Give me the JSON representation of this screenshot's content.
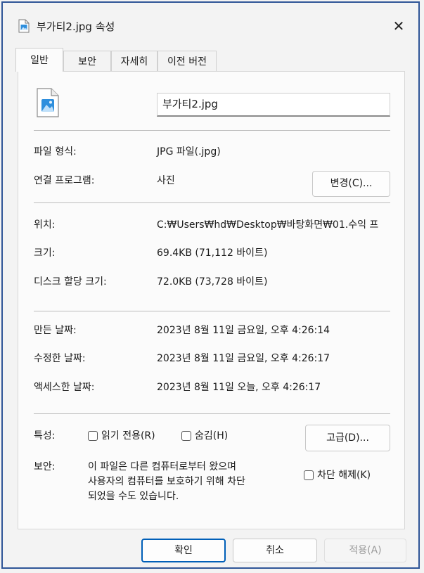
{
  "window": {
    "title": "부가티2.jpg 속성",
    "close": "✕"
  },
  "tabs": [
    {
      "label": "일반",
      "active": true
    },
    {
      "label": "보안"
    },
    {
      "label": "자세히"
    },
    {
      "label": "이전 버전"
    }
  ],
  "general": {
    "filename": "부가티2.jpg",
    "file_type_label": "파일 형식:",
    "file_type_value": "JPG 파일(.jpg)",
    "opens_with_label": "연결 프로그램:",
    "opens_with_value": "사진",
    "change_button": "변경(C)...",
    "location_label": "위치:",
    "location_value": "C:₩Users₩hd₩Desktop₩바탕화면₩01.수익 프",
    "size_label": "크기:",
    "size_value": "69.4KB (71,112 바이트)",
    "size_on_disk_label": "디스크 할당 크기:",
    "size_on_disk_value": "72.0KB (73,728 바이트)",
    "created_label": "만든 날짜:",
    "created_value": "2023년 8월 11일 금요일, 오후 4:26:14",
    "modified_label": "수정한 날짜:",
    "modified_value": "2023년 8월 11일 금요일, 오후 4:26:17",
    "accessed_label": "액세스한 날짜:",
    "accessed_value": "2023년 8월 11일 오늘, 오후 4:26:17",
    "attributes_label": "특성:",
    "readonly_label": "읽기 전용(R)",
    "hidden_label": "숨김(H)",
    "advanced_button": "고급(D)...",
    "security_label": "보안:",
    "security_text_1": "이 파일은 다른 컴퓨터로부터 왔으며",
    "security_text_2": "사용자의 컴퓨터를 보호하기 위해 차단",
    "security_text_3": "되었을 수도 있습니다.",
    "unblock_label": "차단 해제(K)"
  },
  "footer": {
    "ok": "확인",
    "cancel": "취소",
    "apply": "적용(A)"
  },
  "colors": {
    "accent": "#005fb8",
    "frame_border": "#2f5597",
    "image_icon": "#2f8fdd"
  }
}
